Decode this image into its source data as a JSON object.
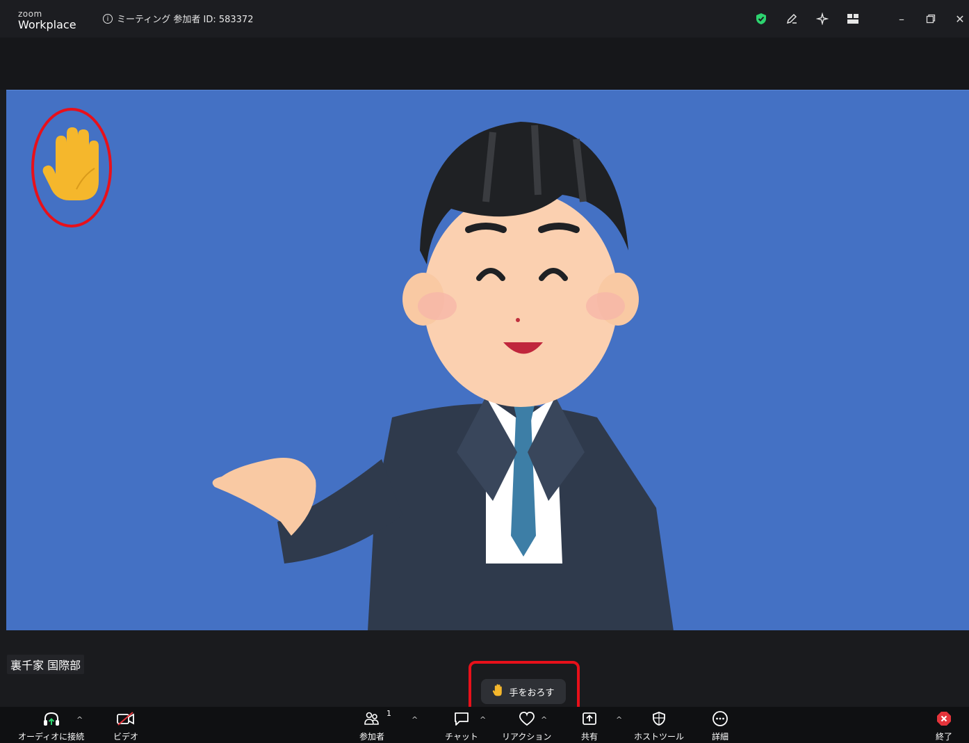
{
  "titlebar": {
    "logo_small": "zoom",
    "logo_big": "Workplace",
    "meeting_info": "ミーティング 参加者 ID: 583372"
  },
  "video": {
    "participant_name": "裏千家 国際部"
  },
  "lower_hand_button": {
    "label": "手をおろす"
  },
  "toolbar": {
    "audio_label": "オーディオに接続",
    "video_label": "ビデオ",
    "participants_label": "参加者",
    "participants_count": "1",
    "chat_label": "チャット",
    "reactions_label": "リアクション",
    "share_label": "共有",
    "host_tools_label": "ホストツール",
    "more_label": "詳細",
    "end_label": "終了"
  },
  "colors": {
    "video_background": "#4471c4",
    "annotation": "#e8101a",
    "shield": "#2dd36f",
    "end_red": "#e5343b"
  }
}
